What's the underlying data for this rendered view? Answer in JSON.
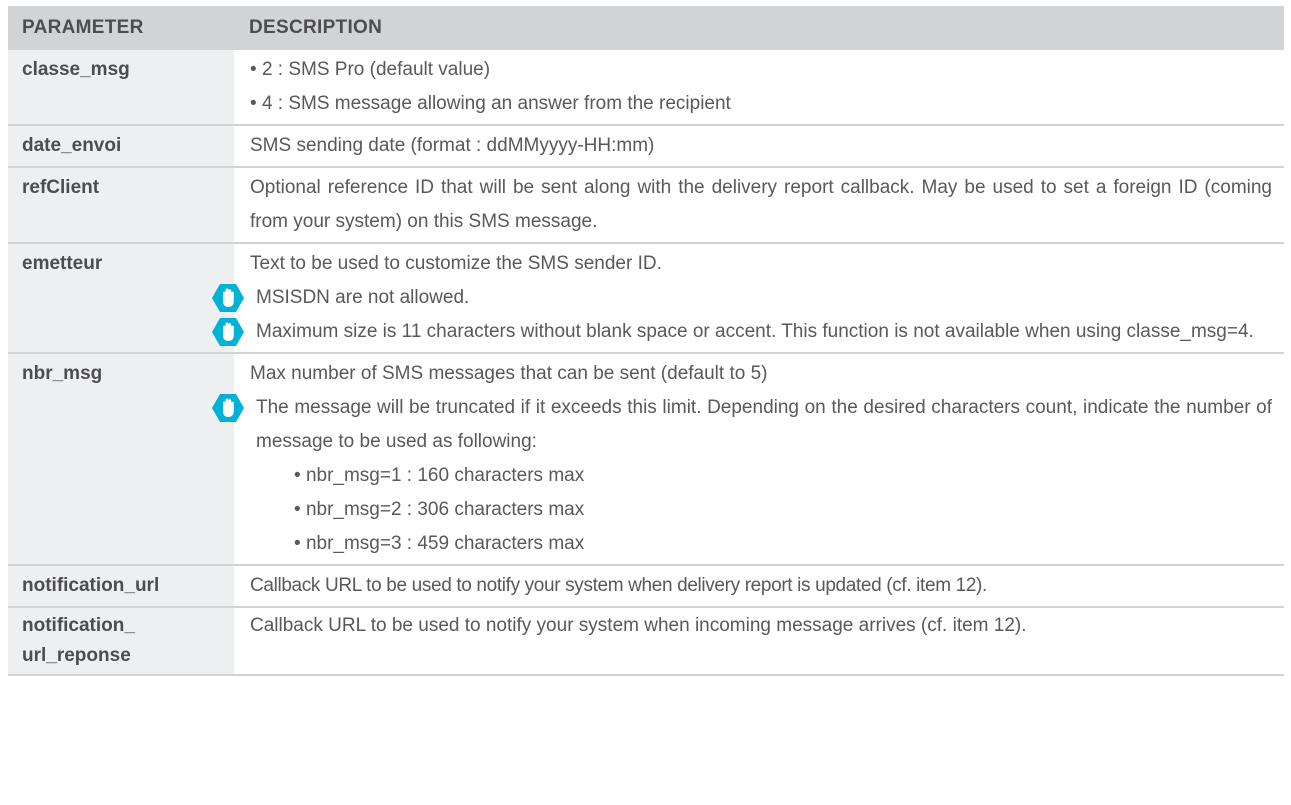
{
  "header": {
    "param": "PARAMETER",
    "desc": "DESCRIPTION"
  },
  "rows": [
    {
      "param": "classe_msg",
      "lines": [
        "2 : SMS Pro (default value)",
        "4 : SMS message allowing an answer from the recipient"
      ]
    },
    {
      "param": "date_envoi",
      "text": "SMS sending date (format : ddMMyyyy-HH:mm)"
    },
    {
      "param": "refClient",
      "text": "Optional reference ID that will be sent along with the delivery report callback. May be used to set a foreign ID (coming from your system) on this SMS message."
    },
    {
      "param": "emetteur",
      "text": "Text to be used to customize the SMS sender ID.",
      "notes": [
        "MSISDN are not allowed.",
        "Maximum size is 11 characters without blank space or accent. This function is not available when using classe_msg=4."
      ]
    },
    {
      "param": "nbr_msg",
      "text": "Max number of SMS messages that can be sent (default to 5)",
      "note": "The message will be truncated if it exceeds this limit. Depending on the desired characters count, indicate the number of message to be used as following:",
      "bullets": [
        "nbr_msg=1 : 160 characters max",
        "nbr_msg=2 : 306 characters max",
        "nbr_msg=3 : 459 characters max"
      ]
    },
    {
      "param": "notification_url",
      "text": "Callback URL to be used to notify your system when delivery report is updated (cf. item 12)."
    },
    {
      "param": "notification_\nurl_reponse",
      "text": "Callback URL to be used to notify your system when incoming message arrives (cf. item 12)."
    }
  ],
  "icons": {
    "note": "hand-stop-icon",
    "note_color": "#00b2d6"
  }
}
